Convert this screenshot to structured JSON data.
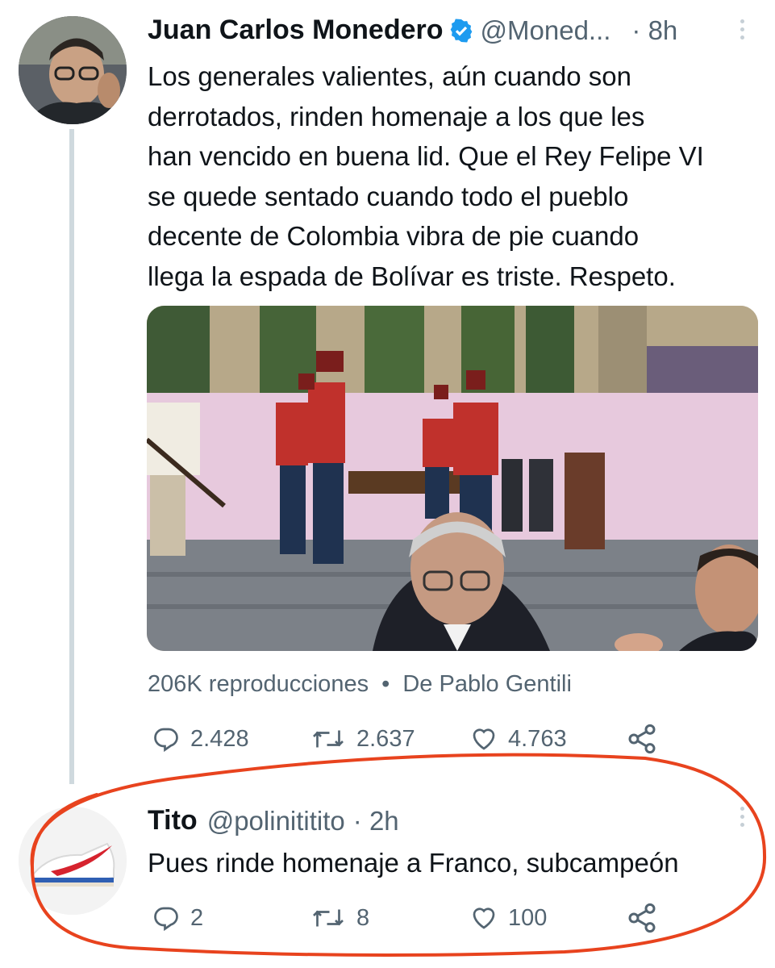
{
  "tweet": {
    "author_name": "Juan Carlos Monedero",
    "author_handle": "@Moned...",
    "time": "· 8h",
    "text_lines": [
      "Los generales valientes, aún cuando son",
      "derrotados, rinden homenaje a los que les",
      "han vencido en buena lid. Que el Rey Felipe VI",
      "se quede sentado cuando todo el pueblo",
      "decente de Colombia vibra de pie cuando",
      "llega la espada de Bolívar es triste. Respeto."
    ],
    "views": "206K reproducciones",
    "separator": "•",
    "source": "De Pablo Gentili",
    "replies": "2.428",
    "retweets": "2.637",
    "likes": "4.763"
  },
  "reply": {
    "author_name": "Tito",
    "author_handle": "@polinititito",
    "time": "· 2h",
    "text": "Pues rinde homenaje a Franco, subcampeón",
    "replies": "2",
    "retweets": "8",
    "likes": "100"
  },
  "colors": {
    "verified": "#1d9bf0",
    "annotation": "#e8431e",
    "secondary_text": "#536471"
  },
  "icons": [
    "verified-badge-icon",
    "more-icon",
    "reply-icon",
    "retweet-icon",
    "like-icon",
    "share-icon"
  ]
}
